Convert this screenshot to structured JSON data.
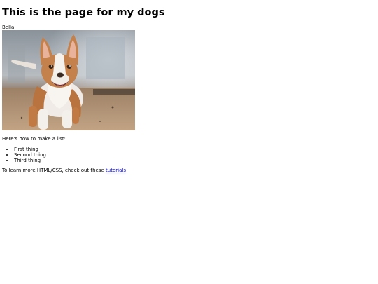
{
  "page": {
    "title": "This is the page for my dogs"
  },
  "dog": {
    "name": "Bella",
    "photo_alt": "Bella"
  },
  "list_section": {
    "intro": "Here's how to make a list:",
    "items": [
      "First thing",
      "Second thing",
      "Third thing"
    ]
  },
  "outro": {
    "before": "To learn more HTML/CSS, check out these ",
    "link_text": "tutorials",
    "after": "!"
  },
  "colors": {
    "link": "#0000ee",
    "text": "#000000",
    "background": "#ffffff"
  }
}
